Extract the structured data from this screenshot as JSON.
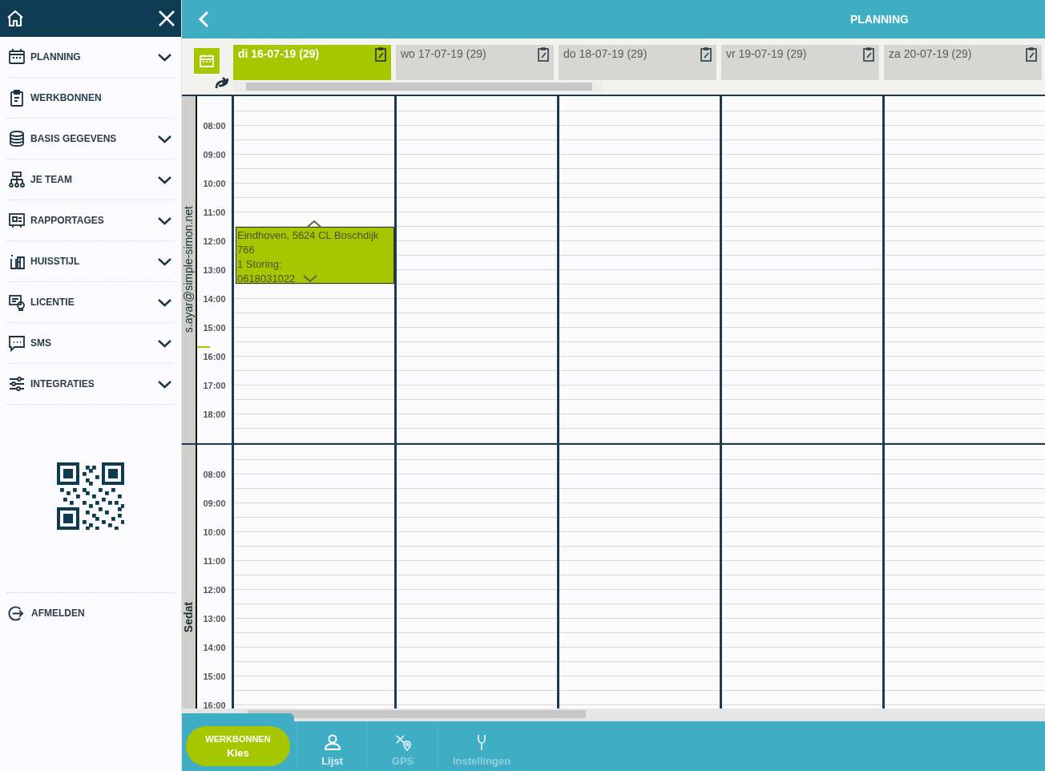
{
  "sidebar": {
    "items": [
      {
        "label": "PLANNING",
        "expandable": true
      },
      {
        "label": "WERKBONNEN",
        "expandable": false
      },
      {
        "label": "BASIS GEGEVENS",
        "expandable": true
      },
      {
        "label": "JE TEAM",
        "expandable": true
      },
      {
        "label": "RAPPORTAGES",
        "expandable": true
      },
      {
        "label": "HUISSTIJL",
        "expandable": true
      },
      {
        "label": "LICENTIE",
        "expandable": true
      },
      {
        "label": "SMS",
        "expandable": true
      },
      {
        "label": "INTEGRATIES",
        "expandable": true
      }
    ],
    "logout": "AFMELDEN"
  },
  "header": {
    "title": "PLANNING"
  },
  "day_tabs": [
    {
      "label": "di 16-07-19 (29)",
      "selected": true
    },
    {
      "label": "wo 17-07-19 (29)",
      "selected": false
    },
    {
      "label": "do 18-07-19 (29)",
      "selected": false
    },
    {
      "label": "vr 19-07-19 (29)",
      "selected": false
    },
    {
      "label": "za 20-07-19 (29)",
      "selected": false
    }
  ],
  "resources": [
    {
      "name": "s.ayar@simple-simon.net",
      "times": [
        "08:00",
        "09:00",
        "10:00",
        "11:00",
        "12:00",
        "13:00",
        "14:00",
        "15:00",
        "16:00",
        "17:00",
        "18:00"
      ],
      "appointments": [
        {
          "lines": [
            "Eindhoven, 5624 CL Boschdijk 766",
            "1 Storing:",
            "0618031022"
          ]
        }
      ]
    },
    {
      "name": "Sedat",
      "times": [
        "08:00",
        "09:00",
        "10:00",
        "11:00",
        "12:00",
        "13:00",
        "14:00",
        "15:00",
        "16:00"
      ]
    }
  ],
  "bottom_nav": {
    "primary": [
      "WERKBONNEN",
      "Kies"
    ],
    "items": [
      {
        "label": "Lijst",
        "disabled": false
      },
      {
        "label": "GPS",
        "disabled": true
      },
      {
        "label": "Instellingen",
        "disabled": true
      }
    ]
  }
}
